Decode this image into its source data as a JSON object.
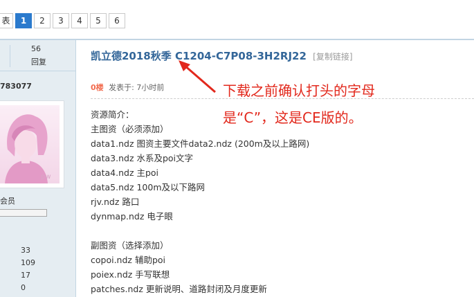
{
  "pager": {
    "list_label": "表",
    "pages": [
      "1",
      "2",
      "3",
      "4",
      "5",
      "6"
    ],
    "active": "1"
  },
  "sidebar": {
    "count_value": "56",
    "count_label": "回复",
    "user_id": "783077",
    "avatar_mark": "pw",
    "rank_label": "会员",
    "stats": [
      "33",
      "109",
      "17",
      "0"
    ]
  },
  "post": {
    "title": "凯立德2018秋季 C1204-C7P08-3H2RJ22",
    "copy_link": "[复制链接]",
    "floor": "0楼",
    "posted": "发表于: 7小时前",
    "lines": [
      "资源简介：",
      "主图资（必须添加）",
      "data1.ndz 图资主要文件data2.ndz (200m及以上路网)",
      "data3.ndz 水系及poi文字",
      "data4.ndz 主poi",
      "data5.ndz 100m及以下路网",
      "rjv.ndz 路口",
      "dynmap.ndz 电子眼",
      "",
      "副图资（选择添加）",
      "copoi.ndz 辅助poi",
      "poiex.ndz 手写联想",
      "patches.ndz 更新说明、道路封闭及月度更新"
    ]
  },
  "annotation": {
    "line1": "下载之前确认打头的字母",
    "line2": "是“C”，这是CE版的。",
    "color": "#e2281c"
  }
}
